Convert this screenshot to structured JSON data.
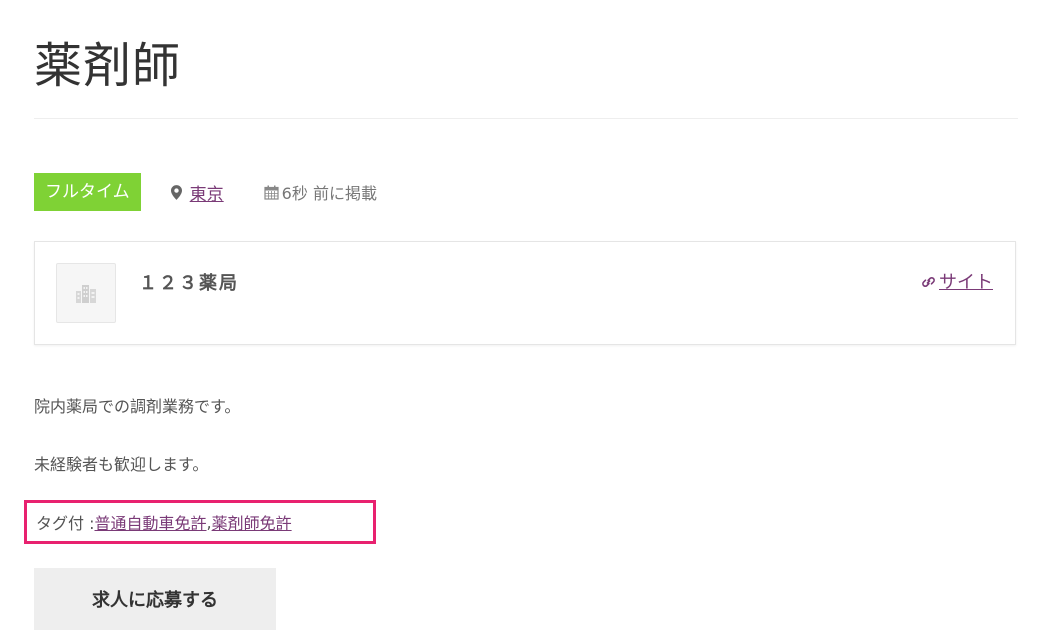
{
  "job": {
    "title": "薬剤師",
    "type_badge": "フルタイム",
    "location": "東京",
    "posted": "6秒 前に掲載",
    "colors": {
      "badge": "#7fd235",
      "link": "#7a3a77",
      "highlight_box": "#e8216f"
    }
  },
  "company": {
    "name": "１２３薬局",
    "site_label": "サイト",
    "logo_icon": "building-placeholder-icon"
  },
  "description": [
    "院内薬局での調剤業務です。",
    "未経験者も歓迎します。"
  ],
  "tags": {
    "label": "タグ付 : ",
    "items": [
      "普通自動車免許",
      "薬剤師免許"
    ],
    "separator": ", "
  },
  "apply_button": "求人に応募する"
}
